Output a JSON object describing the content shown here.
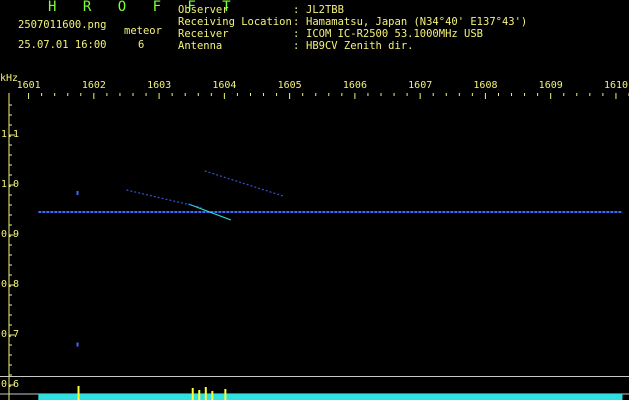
{
  "header": {
    "app_name": "H R O F F T",
    "filename": "2507011600.png",
    "datetime": "25.07.01 16:00",
    "meteor_label": "meteor",
    "meteor_count": "6"
  },
  "station_info": [
    {
      "label": "Observer",
      "value": "JL2TBB"
    },
    {
      "label": "Receiving Location",
      "value": "Hamamatsu, Japan (N34°40' E137°43')"
    },
    {
      "label": "Receiver",
      "value": "ICOM IC-R2500 53.1000MHz USB"
    },
    {
      "label": "Antenna",
      "value": "HB9CV Zenith dir."
    }
  ],
  "colors": {
    "header_text": "#7CFF3C",
    "axis_text": "#F4F27A",
    "carrier_line": "#3A6CFF",
    "signal_trace": "#2FE0E0",
    "signal_peak": "#FFFF33",
    "grid_line": "#C8C8C8"
  },
  "chart_data": {
    "type": "spectrogram",
    "y_unit": "kHz",
    "x_ticks": [
      "1601",
      "1602",
      "1603",
      "1604",
      "1605",
      "1606",
      "1607",
      "1608",
      "1609",
      "1610"
    ],
    "x_range": [
      1600.7,
      1610.2
    ],
    "y_ticks": [
      "1.1",
      "1.0",
      "0.9",
      "0.8",
      "0.7",
      "0.6"
    ],
    "y_range": [
      0.57,
      1.18
    ],
    "carrier": {
      "freq_khz": 0.946,
      "start_min": 1601.15,
      "end_min": 1610.1
    },
    "meteor_echoes": [
      {
        "start_min": 1603.45,
        "end_min": 1604.1,
        "freq_start": 0.962,
        "freq_end": 0.93
      },
      {
        "start_min": 1603.7,
        "end_min": 1604.9,
        "freq_start": 1.028,
        "freq_end": 0.978
      },
      {
        "start_min": 1602.5,
        "end_min": 1603.65,
        "freq_start": 0.99,
        "freq_end": 0.955
      }
    ],
    "dots": [
      {
        "time_min": 1601.75,
        "freq_khz": 0.984
      },
      {
        "time_min": 1601.75,
        "freq_khz": 0.681
      }
    ],
    "reference_lines_khz": [
      0.617,
      0.582
    ]
  }
}
